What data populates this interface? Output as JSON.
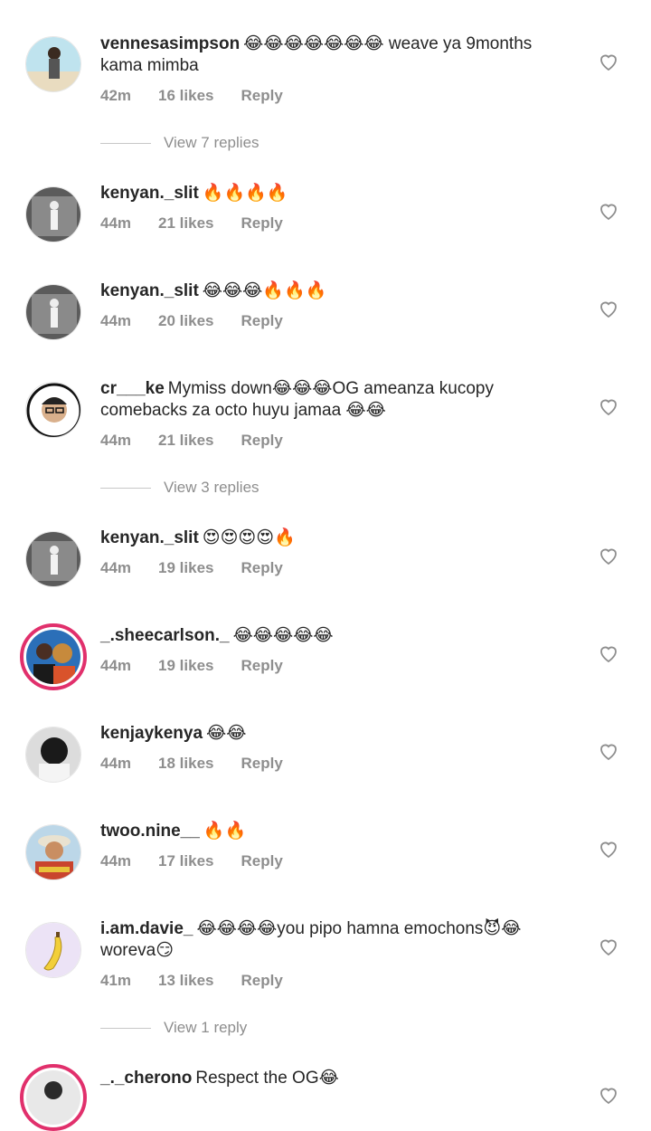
{
  "comments": [
    {
      "username": "vennesasimpson",
      "text": "😂😂😂😂😂😂😂 weave ya 9months kama mimba",
      "time": "42m",
      "likes": "16 likes",
      "reply": "Reply",
      "view_replies": "View 7 replies"
    },
    {
      "username": "kenyan._slit",
      "text": "🔥🔥🔥🔥",
      "time": "44m",
      "likes": "21 likes",
      "reply": "Reply"
    },
    {
      "username": "kenyan._slit",
      "text": "😂😂😂🔥🔥🔥",
      "time": "44m",
      "likes": "20 likes",
      "reply": "Reply"
    },
    {
      "username": "cr___ke",
      "text": "Mymiss down😂😂😂OG ameanza kucopy comebacks za octo huyu jamaa 😂😂",
      "time": "44m",
      "likes": "21 likes",
      "reply": "Reply",
      "view_replies": "View 3 replies"
    },
    {
      "username": "kenyan._slit",
      "text": "😍😍😍😍🔥",
      "time": "44m",
      "likes": "19 likes",
      "reply": "Reply"
    },
    {
      "username": "_.sheecarlson._",
      "text": "😂😂😂😂😂",
      "time": "44m",
      "likes": "19 likes",
      "reply": "Reply"
    },
    {
      "username": "kenjaykenya",
      "text": "😂😂",
      "time": "44m",
      "likes": "18 likes",
      "reply": "Reply"
    },
    {
      "username": "twoo.nine__",
      "text": "🔥🔥",
      "time": "44m",
      "likes": "17 likes",
      "reply": "Reply"
    },
    {
      "username": "i.am.davie_",
      "text": "😂😂😂😂you pipo hamna emochons😈😂 woreva😏",
      "time": "41m",
      "likes": "13 likes",
      "reply": "Reply",
      "view_replies": "View 1 reply"
    },
    {
      "username": "_._cherono",
      "text": "Respect the OG😂"
    }
  ]
}
